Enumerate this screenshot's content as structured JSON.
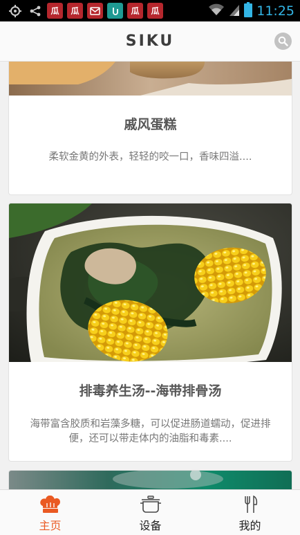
{
  "status_bar": {
    "time": "11:25",
    "app_icons": [
      "瓜",
      "瓜",
      "",
      "",
      "瓜",
      "瓜"
    ]
  },
  "header": {
    "title": "SIKU",
    "search_icon": "search-icon"
  },
  "feed": {
    "items": [
      {
        "title": "戚风蛋糕",
        "description": "柔软金黄的外表，轻轻的咬一口，香味四溢...."
      },
      {
        "title": "排毒养生汤--海带排骨汤",
        "description": "海带富含胶质和岩藻多糖，可以促进肠道蠕动，促进排便，还可以带走体内的油脂和毒素...."
      },
      {
        "title": "",
        "description": ""
      }
    ]
  },
  "bottom_nav": {
    "items": [
      {
        "label": "主页",
        "icon": "chef-hat-icon",
        "active": true
      },
      {
        "label": "设备",
        "icon": "cooking-pot-icon",
        "active": false
      },
      {
        "label": "我的",
        "icon": "fork-knife-icon",
        "active": false
      }
    ]
  },
  "colors": {
    "accent": "#ea5a23",
    "status_time": "#33b5e5"
  }
}
